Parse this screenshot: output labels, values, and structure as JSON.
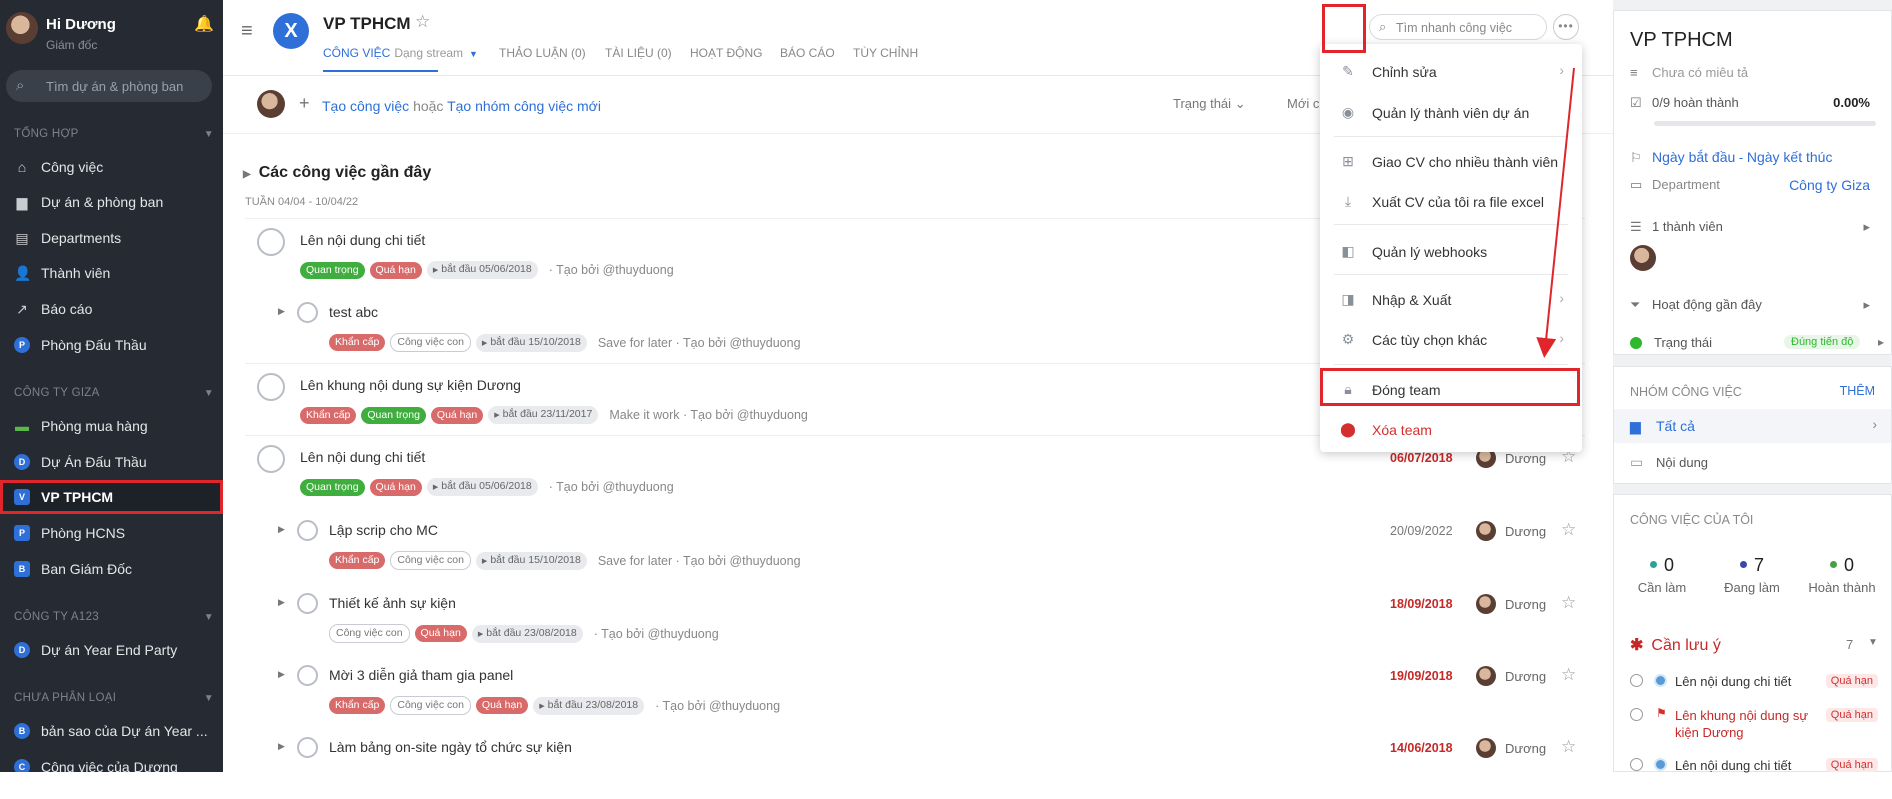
{
  "sidebar": {
    "user_name": "Hi Dương",
    "user_role": "Giám đốc",
    "search_placeholder": "Tìm dự án & phòng ban",
    "sections": [
      {
        "label": "TỔNG HỢP"
      },
      {
        "label": "CÔNG TY GIZA"
      },
      {
        "label": "CÔNG TY A123"
      },
      {
        "label": "CHƯA PHÂN LOẠI"
      }
    ],
    "items": [
      {
        "label": "Công việc",
        "icon": "home-icon"
      },
      {
        "label": "Dự án & phòng ban",
        "icon": "folder-icon"
      },
      {
        "label": "Departments",
        "icon": "building-icon"
      },
      {
        "label": "Thành viên",
        "icon": "users-icon"
      },
      {
        "label": "Báo cáo",
        "icon": "chart-icon"
      },
      {
        "label": "Phòng Đấu Thầu",
        "badge": "P"
      },
      {
        "label": "Phòng mua hàng",
        "icon": "briefcase-icon"
      },
      {
        "label": "Dự Án Đấu Thầu",
        "badge": "D"
      },
      {
        "label": "VP TPHCM",
        "badge": "V"
      },
      {
        "label": "Phòng HCNS",
        "badge": "P"
      },
      {
        "label": "Ban Giám Đốc",
        "badge": "B"
      },
      {
        "label": "Dự án Year End Party",
        "badge": "D"
      },
      {
        "label": "bản sao của Dự án Year ...",
        "badge": "B"
      },
      {
        "label": "Công việc của Dương",
        "badge": "C"
      }
    ]
  },
  "header": {
    "logo_letter": "X",
    "title": "VP TPHCM",
    "tabs": [
      {
        "label": "CÔNG VIỆC",
        "sub": "Dạng stream"
      },
      {
        "label": "THẢO LUẬN (0)"
      },
      {
        "label": "TÀI LIỆU (0)"
      },
      {
        "label": "HOẠT ĐỘNG"
      },
      {
        "label": "BÁO CÁO"
      },
      {
        "label": "TÙY CHỈNH"
      }
    ],
    "search_placeholder": "Tìm nhanh công việc",
    "more": "•••"
  },
  "create_bar": {
    "create_task": "Tạo công việc",
    "or": "hoặc",
    "create_group": "Tạo nhóm công việc mới",
    "status_filter": "Trạng thái",
    "sort": "Mới c"
  },
  "group": {
    "title": "Các công việc gần đây",
    "week": "TUẦN 04/04 - 10/04/22"
  },
  "tasks": [
    {
      "title": "Lên nội dung chi tiết",
      "tags": [
        {
          "t": "Quan trọng",
          "c": "g"
        },
        {
          "t": "Quá hạn",
          "c": "r"
        },
        {
          "t": "bắt đầu 05/06/2018",
          "c": "s"
        }
      ],
      "meta": "· Tạo bởi @thuyduong",
      "sub": false
    },
    {
      "title": "test abc",
      "tags": [
        {
          "t": "Khẩn cấp",
          "c": "r"
        },
        {
          "t": "Công việc con",
          "c": "o"
        },
        {
          "t": "bắt đầu 15/10/2018",
          "c": "s"
        }
      ],
      "meta": "Save for later · Tạo bởi @thuyduong",
      "sub": true
    },
    {
      "title": "Lên khung nội dung sự kiện Dương",
      "tags": [
        {
          "t": "Khẩn cấp",
          "c": "r"
        },
        {
          "t": "Quan trọng",
          "c": "g"
        },
        {
          "t": "Quá hạn",
          "c": "r"
        },
        {
          "t": "bắt đầu 23/11/2017",
          "c": "s"
        }
      ],
      "meta": "Make it work · Tạo bởi @thuyduong",
      "sub": false
    },
    {
      "title": "Lên nội dung chi tiết",
      "tags": [
        {
          "t": "Quan trọng",
          "c": "g"
        },
        {
          "t": "Quá hạn",
          "c": "r"
        },
        {
          "t": "bắt đầu 05/06/2018",
          "c": "s"
        }
      ],
      "meta": "· Tạo bởi @thuyduong",
      "sub": false,
      "due": "06/07/2018",
      "due_color": "red",
      "user": "Dương"
    },
    {
      "title": "Lập scrip cho MC",
      "tags": [
        {
          "t": "Khẩn cấp",
          "c": "r"
        },
        {
          "t": "Công việc con",
          "c": "o"
        },
        {
          "t": "bắt đầu 15/10/2018",
          "c": "s"
        }
      ],
      "meta": "Save for later · Tạo bởi @thuyduong",
      "sub": true,
      "due": "20/09/2022",
      "due_color": "gray",
      "user": "Dương"
    },
    {
      "title": "Thiết kế ảnh sự kiện",
      "tags": [
        {
          "t": "Công việc con",
          "c": "o"
        },
        {
          "t": "Quá hạn",
          "c": "r"
        },
        {
          "t": "bắt đầu 23/08/2018",
          "c": "s"
        }
      ],
      "meta": "· Tạo bởi @thuyduong",
      "sub": true,
      "due": "18/09/2018",
      "due_color": "red",
      "user": "Dương"
    },
    {
      "title": "Mời 3 diễn giả tham gia panel",
      "tags": [
        {
          "t": "Khẩn cấp",
          "c": "r"
        },
        {
          "t": "Công việc con",
          "c": "o"
        },
        {
          "t": "Quá hạn",
          "c": "r"
        },
        {
          "t": "bắt đầu 23/08/2018",
          "c": "s"
        }
      ],
      "meta": "· Tạo bởi @thuyduong",
      "sub": true,
      "due": "19/09/2018",
      "due_color": "red",
      "user": "Dương"
    },
    {
      "title": "Làm bảng on-site ngày tổ chức sự kiện",
      "tags": [],
      "meta": "",
      "sub": true,
      "due": "14/06/2018",
      "due_color": "red",
      "user": "Dương"
    }
  ],
  "menu": {
    "items": [
      {
        "label": "Chỉnh sửa",
        "icon": "pencil-icon",
        "chevron": "›"
      },
      {
        "label": "Quản lý thành viên dự án",
        "icon": "user-circle-icon"
      },
      {
        "label": "Giao CV cho nhiều thành viên",
        "icon": "plus-square-icon"
      },
      {
        "label": "Xuất CV của tôi ra file excel",
        "icon": "download-icon"
      },
      {
        "label": "Quản lý webhooks",
        "icon": "webhook-icon"
      },
      {
        "label": "Nhập & Xuất",
        "icon": "import-export-icon",
        "chevron": "›"
      },
      {
        "label": "Các tùy chọn khác",
        "icon": "gear-icon",
        "chevron": "›"
      },
      {
        "label": "Đóng team",
        "icon": "lock-icon"
      },
      {
        "label": "Xóa team",
        "icon": "alert-icon"
      }
    ]
  },
  "right_panel": {
    "title": "VP TPHCM",
    "desc": "Chưa có miêu tả",
    "progress_text": "0/9 hoàn thành",
    "progress_pct": "0.00%",
    "start": "Ngày bắt đầu",
    "sep": " - ",
    "end": "Ngày kết thúc",
    "dept_label": "Department",
    "dept_value": "Công ty Giza",
    "members": "1 thành viên",
    "activity": "Hoạt động gần đây",
    "status_label": "Trạng thái",
    "status_value": "Đúng tiến độ",
    "groups_title": "NHÓM CÔNG VIỆC",
    "groups_add": "THÊM",
    "group_all": "Tất cả",
    "group_content": "Nội dung",
    "my_tasks_title": "CÔNG VIỆC CỦA TÔI",
    "counts": [
      {
        "value": "0",
        "label": "Cần làm",
        "color": "#26a69a"
      },
      {
        "value": "7",
        "label": "Đang làm",
        "color": "#3949ab"
      },
      {
        "value": "0",
        "label": "Hoàn thành",
        "color": "#43a047"
      }
    ],
    "attention_title": "Cần lưu ý",
    "attention_count": "7",
    "attention_items": [
      {
        "text": "Lên nội dung chi tiết",
        "badge": "Quá hạn",
        "flag": false
      },
      {
        "text": "Lên khung nội dung sự kiện Dương",
        "badge": "Quá hạn",
        "flag": true
      },
      {
        "text": "Lên nội dung chi tiết",
        "badge": "Quá hạn",
        "flag": false
      }
    ]
  },
  "colors": {
    "accent": "#2e6fd8",
    "sidebar_bg": "#262b33",
    "highlight": "#e0262b"
  }
}
